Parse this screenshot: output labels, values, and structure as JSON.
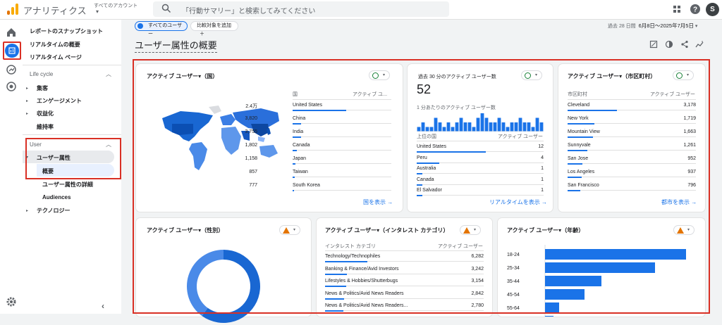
{
  "topbar": {
    "app_title": "アナリティクス",
    "account_label": "すべてのアカウント",
    "search_placeholder": "「行動サマリー」と検索してみてください",
    "avatar_initial": "S"
  },
  "nav": {
    "snapshot": "レポートのスナップショット",
    "realtime_overview": "リアルタイムの概要",
    "realtime_pages": "リアルタイム ページ",
    "lifecycle_section": "Life cycle",
    "acquisition": "集客",
    "engagement": "エンゲージメント",
    "monetization": "収益化",
    "retention": "維持率",
    "user_section": "User",
    "user_attributes": "ユーザー属性",
    "overview": "概要",
    "user_attr_detail": "ユーザー属性の詳細",
    "audiences": "Audiences",
    "tech": "テクノロジー"
  },
  "toolbar": {
    "all_users_chip": "すべてのユーザー",
    "add_comparison": "比較対象を追加",
    "date_prefix": "過去 28 日間",
    "date_range": "6月8日～2025年7月5日"
  },
  "page_title": "ユーザー属性の概要",
  "cards": {
    "country": {
      "title": "アクティブ ユーザー▾（国）",
      "col1": "国",
      "col2": "アクティブ ユ...",
      "rows": [
        {
          "name": "United States",
          "value": "2.4万",
          "share": 1.0
        },
        {
          "name": "China",
          "value": "3,820",
          "share": 0.16
        },
        {
          "name": "India",
          "value": "3,755",
          "share": 0.16
        },
        {
          "name": "Canada",
          "value": "1,802",
          "share": 0.08
        },
        {
          "name": "Japan",
          "value": "1,158",
          "share": 0.05
        },
        {
          "name": "Taiwan",
          "value": "857",
          "share": 0.04
        },
        {
          "name": "South Korea",
          "value": "777",
          "share": 0.03
        }
      ],
      "link": "国を表示"
    },
    "realtime": {
      "title": "過去 30 分のアクティブ ユーザー数",
      "value": "52",
      "per_minute": "1 分あたりのアクティブ ユーザー数",
      "col1": "上位の国",
      "col2": "アクティブ ユーザー",
      "rows": [
        {
          "name": "United States",
          "value": "12",
          "share": 1.0
        },
        {
          "name": "Peru",
          "value": "4",
          "share": 0.33
        },
        {
          "name": "Australia",
          "value": "1",
          "share": 0.08
        },
        {
          "name": "Canada",
          "value": "1",
          "share": 0.08
        },
        {
          "name": "El Salvador",
          "value": "1",
          "share": 0.08
        }
      ],
      "link": "リアルタイムを表示",
      "minute_values": [
        1,
        2,
        1,
        1,
        3,
        2,
        1,
        2,
        1,
        2,
        3,
        2,
        2,
        1,
        3,
        4,
        3,
        2,
        2,
        3,
        2,
        1,
        2,
        2,
        3,
        2,
        2,
        1,
        3,
        2
      ]
    },
    "city": {
      "title": "アクティブ ユーザー▾（市区町村）",
      "col1": "市区町村",
      "col2": "アクティブ ユーザー",
      "rows": [
        {
          "name": "Cleveland",
          "value": "3,178",
          "share": 1.0
        },
        {
          "name": "New York",
          "value": "1,719",
          "share": 0.54
        },
        {
          "name": "Mountain View",
          "value": "1,663",
          "share": 0.52
        },
        {
          "name": "Sunnyvale",
          "value": "1,261",
          "share": 0.4
        },
        {
          "name": "San Jose",
          "value": "952",
          "share": 0.3
        },
        {
          "name": "Los Angeles",
          "value": "937",
          "share": 0.29
        },
        {
          "name": "San Francisco",
          "value": "796",
          "share": 0.25
        }
      ],
      "link": "都市を表示"
    },
    "gender": {
      "title": "アクティブ ユーザー▾（性別）"
    },
    "interest": {
      "title": "アクティブ ユーザー▾（インタレスト カテゴリ）",
      "col1": "インタレスト カテゴリ",
      "col2": "アクティブ ユーザー",
      "rows": [
        {
          "name": "Technology/Technophiles",
          "value": "6,282",
          "share": 1.0
        },
        {
          "name": "Banking & Finance/Avid Investors",
          "value": "3,242",
          "share": 0.52
        },
        {
          "name": "Lifestyles & Hobbies/Shutterbugs",
          "value": "3,154",
          "share": 0.5
        },
        {
          "name": "News & Politics/Avid News Readers",
          "value": "2,842",
          "share": 0.45
        },
        {
          "name": "News & Politics/Avid News Readers...",
          "value": "2,780",
          "share": 0.44
        }
      ]
    },
    "age": {
      "title": "アクティブ ユーザー▾（年齢）"
    }
  },
  "chart_data": [
    {
      "type": "bar",
      "orientation": "horizontal",
      "categories": [
        "18-24",
        "25-34",
        "35-44",
        "45-54",
        "55-64"
      ],
      "values": [
        100,
        78,
        40,
        28,
        10
      ]
    },
    {
      "type": "bar",
      "categories": [],
      "values": [
        1,
        2,
        1,
        1,
        3,
        2,
        1,
        2,
        1,
        2,
        3,
        2,
        2,
        1,
        3,
        4,
        3,
        2,
        2,
        3,
        2,
        1,
        2,
        2,
        3,
        2,
        2,
        1,
        3,
        2
      ]
    },
    {
      "type": "pie",
      "values": [
        60,
        40
      ]
    }
  ],
  "colors": {
    "accent": "#1a73e8",
    "highlight": "#d93025"
  }
}
